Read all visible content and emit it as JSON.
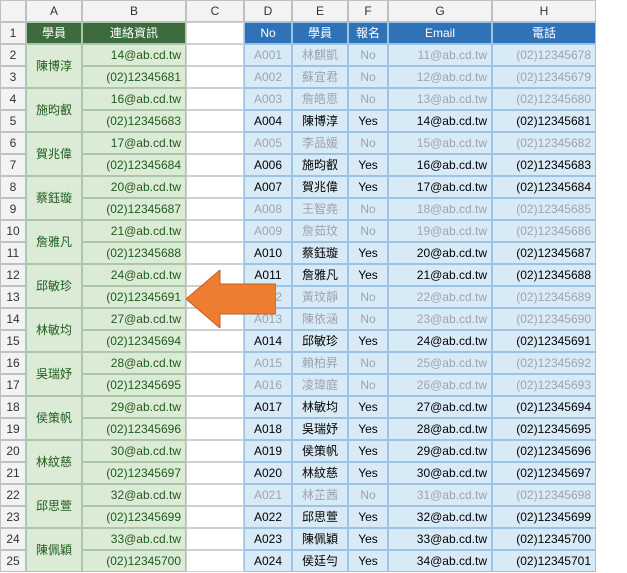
{
  "colHeaders": [
    "A",
    "B",
    "C",
    "D",
    "E",
    "F",
    "G",
    "H"
  ],
  "rowHeaders": [
    "1",
    "2",
    "3",
    "4",
    "5",
    "6",
    "7",
    "8",
    "9",
    "10",
    "11",
    "12",
    "13",
    "14",
    "15",
    "16",
    "17",
    "18",
    "19",
    "20",
    "21",
    "22",
    "23",
    "24",
    "25"
  ],
  "left": {
    "headers": {
      "a": "學員",
      "b": "連絡資訊"
    },
    "groups": [
      {
        "name": "陳博淳",
        "v1": "14@ab.cd.tw",
        "v2": "(02)12345681"
      },
      {
        "name": "施昀叡",
        "v1": "16@ab.cd.tw",
        "v2": "(02)12345683"
      },
      {
        "name": "賀兆偉",
        "v1": "17@ab.cd.tw",
        "v2": "(02)12345684"
      },
      {
        "name": "蔡鈺璇",
        "v1": "20@ab.cd.tw",
        "v2": "(02)12345687"
      },
      {
        "name": "詹雅凡",
        "v1": "21@ab.cd.tw",
        "v2": "(02)12345688"
      },
      {
        "name": "邱敏珍",
        "v1": "24@ab.cd.tw",
        "v2": "(02)12345691"
      },
      {
        "name": "林敏均",
        "v1": "27@ab.cd.tw",
        "v2": "(02)12345694"
      },
      {
        "name": "吳瑞妤",
        "v1": "28@ab.cd.tw",
        "v2": "(02)12345695"
      },
      {
        "name": "侯策帆",
        "v1": "29@ab.cd.tw",
        "v2": "(02)12345696"
      },
      {
        "name": "林紋慈",
        "v1": "30@ab.cd.tw",
        "v2": "(02)12345697"
      },
      {
        "name": "邱思萱",
        "v1": "32@ab.cd.tw",
        "v2": "(02)12345699"
      },
      {
        "name": "陳佩穎",
        "v1": "33@ab.cd.tw",
        "v2": "(02)12345700"
      }
    ]
  },
  "right": {
    "headers": {
      "no": "No",
      "name": "學員",
      "signup": "報名",
      "email": "Email",
      "phone": "電話"
    },
    "rows": [
      {
        "no": "A001",
        "name": "林麒凱",
        "signup": "No",
        "email": "11@ab.cd.tw",
        "phone": "(02)12345678",
        "active": false
      },
      {
        "no": "A002",
        "name": "蘇宜君",
        "signup": "No",
        "email": "12@ab.cd.tw",
        "phone": "(02)12345679",
        "active": false
      },
      {
        "no": "A003",
        "name": "詹皓恩",
        "signup": "No",
        "email": "13@ab.cd.tw",
        "phone": "(02)12345680",
        "active": false
      },
      {
        "no": "A004",
        "name": "陳博淳",
        "signup": "Yes",
        "email": "14@ab.cd.tw",
        "phone": "(02)12345681",
        "active": true
      },
      {
        "no": "A005",
        "name": "李品媛",
        "signup": "No",
        "email": "15@ab.cd.tw",
        "phone": "(02)12345682",
        "active": false
      },
      {
        "no": "A006",
        "name": "施昀叡",
        "signup": "Yes",
        "email": "16@ab.cd.tw",
        "phone": "(02)12345683",
        "active": true
      },
      {
        "no": "A007",
        "name": "賀兆偉",
        "signup": "Yes",
        "email": "17@ab.cd.tw",
        "phone": "(02)12345684",
        "active": true
      },
      {
        "no": "A008",
        "name": "王智堯",
        "signup": "No",
        "email": "18@ab.cd.tw",
        "phone": "(02)12345685",
        "active": false
      },
      {
        "no": "A009",
        "name": "詹茹玟",
        "signup": "No",
        "email": "19@ab.cd.tw",
        "phone": "(02)12345686",
        "active": false
      },
      {
        "no": "A010",
        "name": "蔡鈺璇",
        "signup": "Yes",
        "email": "20@ab.cd.tw",
        "phone": "(02)12345687",
        "active": true
      },
      {
        "no": "A011",
        "name": "詹雅凡",
        "signup": "Yes",
        "email": "21@ab.cd.tw",
        "phone": "(02)12345688",
        "active": true
      },
      {
        "no": "A012",
        "name": "黃玟靜",
        "signup": "No",
        "email": "22@ab.cd.tw",
        "phone": "(02)12345689",
        "active": false
      },
      {
        "no": "A013",
        "name": "陳依涵",
        "signup": "No",
        "email": "23@ab.cd.tw",
        "phone": "(02)12345690",
        "active": false
      },
      {
        "no": "A014",
        "name": "邱敏珍",
        "signup": "Yes",
        "email": "24@ab.cd.tw",
        "phone": "(02)12345691",
        "active": true
      },
      {
        "no": "A015",
        "name": "賴柏昇",
        "signup": "No",
        "email": "25@ab.cd.tw",
        "phone": "(02)12345692",
        "active": false
      },
      {
        "no": "A016",
        "name": "凌瑋庭",
        "signup": "No",
        "email": "26@ab.cd.tw",
        "phone": "(02)12345693",
        "active": false
      },
      {
        "no": "A017",
        "name": "林敏均",
        "signup": "Yes",
        "email": "27@ab.cd.tw",
        "phone": "(02)12345694",
        "active": true
      },
      {
        "no": "A018",
        "name": "吳瑞妤",
        "signup": "Yes",
        "email": "28@ab.cd.tw",
        "phone": "(02)12345695",
        "active": true
      },
      {
        "no": "A019",
        "name": "侯策帆",
        "signup": "Yes",
        "email": "29@ab.cd.tw",
        "phone": "(02)12345696",
        "active": true
      },
      {
        "no": "A020",
        "name": "林紋慈",
        "signup": "Yes",
        "email": "30@ab.cd.tw",
        "phone": "(02)12345697",
        "active": true
      },
      {
        "no": "A021",
        "name": "林芷茜",
        "signup": "No",
        "email": "31@ab.cd.tw",
        "phone": "(02)12345698",
        "active": false
      },
      {
        "no": "A022",
        "name": "邱思萱",
        "signup": "Yes",
        "email": "32@ab.cd.tw",
        "phone": "(02)12345699",
        "active": true
      },
      {
        "no": "A023",
        "name": "陳佩穎",
        "signup": "Yes",
        "email": "33@ab.cd.tw",
        "phone": "(02)12345700",
        "active": true
      },
      {
        "no": "A024",
        "name": "侯廷勻",
        "signup": "Yes",
        "email": "34@ab.cd.tw",
        "phone": "(02)12345701",
        "active": true
      }
    ]
  }
}
